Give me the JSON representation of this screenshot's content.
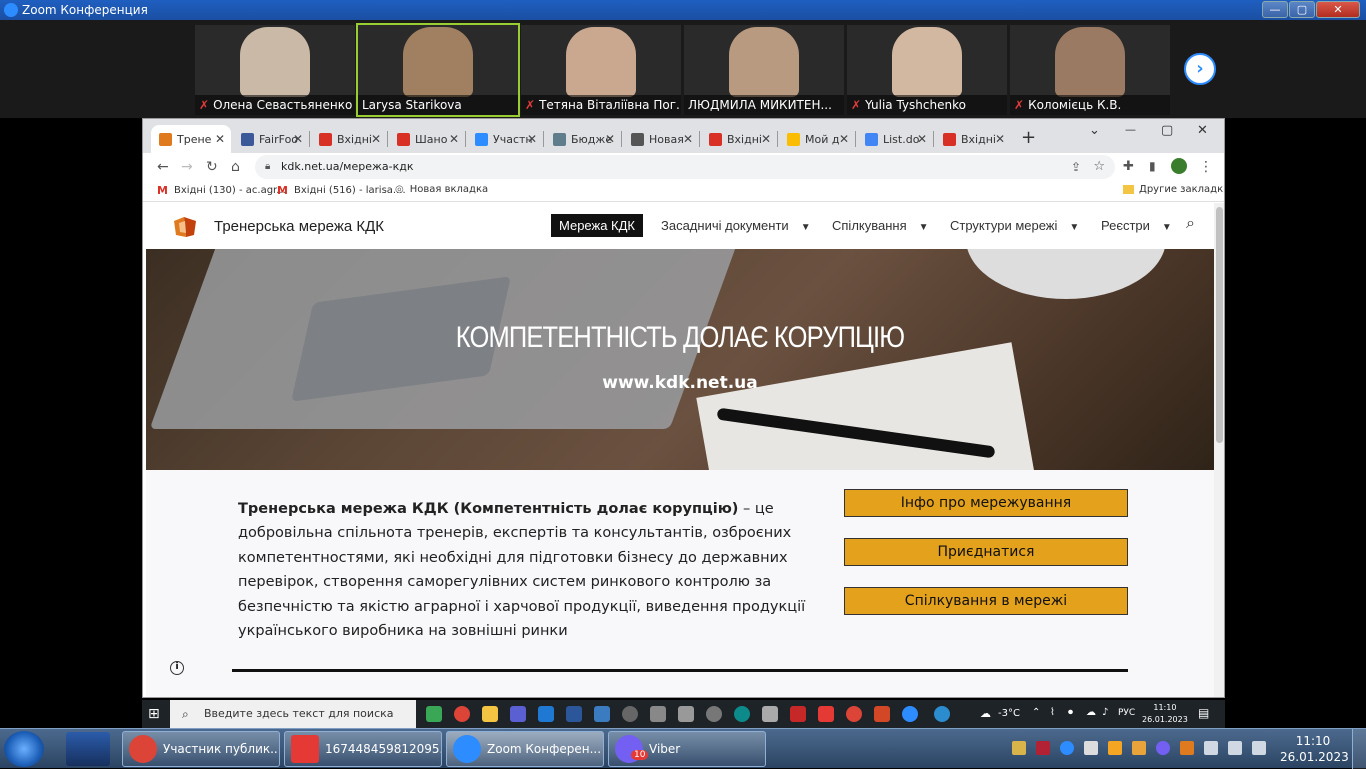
{
  "zoom": {
    "title": "Zoom Конференция",
    "controls": {
      "min": "—",
      "max": "▢",
      "close": "✕"
    },
    "participants": [
      {
        "name": "Олена Севастьяненко",
        "muted": true,
        "color": "#c9b9a6"
      },
      {
        "name": "Larysa Starikova",
        "muted": false,
        "color": "#a08060"
      },
      {
        "name": "Тетяна Віталіївна Пог...",
        "muted": true,
        "color": "#caa890"
      },
      {
        "name": "ЛЮДМИЛА МИКИТЕН...",
        "muted": false,
        "color": "#b89a80"
      },
      {
        "name": "Yulia Tyshchenko",
        "muted": true,
        "color": "#d2b8a0"
      },
      {
        "name": "Коломієць К.В.",
        "muted": true,
        "color": "#9a7a62"
      }
    ],
    "next": "›"
  },
  "browser": {
    "tabs": [
      {
        "label": "Трене",
        "color": "#e07a1f"
      },
      {
        "label": "FairFoo",
        "color": "#3b5998"
      },
      {
        "label": "Вхідні",
        "color": "#d93025"
      },
      {
        "label": "Шано",
        "color": "#d93025"
      },
      {
        "label": "Участн",
        "color": "#2d8cff"
      },
      {
        "label": "Бюдже",
        "color": "#607d8b"
      },
      {
        "label": "Новая",
        "color": "#555555"
      },
      {
        "label": "Вхідні",
        "color": "#d93025"
      },
      {
        "label": "Мой д",
        "color": "#fbbc04"
      },
      {
        "label": "List.do",
        "color": "#4285f4"
      },
      {
        "label": "Вхідні",
        "color": "#d93025"
      }
    ],
    "new_tab": "+",
    "window_controls": {
      "dropdown": "⌄",
      "min": "—",
      "max": "▢",
      "close": "✕"
    },
    "url": "kdk.net.ua/мережа-кдк",
    "bookmarks": [
      {
        "label": "Вхідні (130) - ac.agr..."
      },
      {
        "label": "Вхідні (516) - larisa...."
      },
      {
        "label": "Новая вкладка"
      }
    ],
    "other_bookmarks": "Другие закладки"
  },
  "site": {
    "name": "Тренерська мережа КДК",
    "nav": {
      "active": "Мережа КДК",
      "items": [
        "Засадничі документи",
        "Спілкування",
        "Структури мережі",
        "Реєстри"
      ]
    },
    "hero": {
      "title": "КОМПЕТЕНТНІСТЬ ДОЛАЄ КОРУПЦІЮ",
      "url": "www.kdk.net.ua"
    },
    "intro_bold": "Тренерська мережа КДК (Компетентність долає корупцію)",
    "intro_rest": " – це добровільна спільнота тренерів, експертів та консультантів, озброєних компетентностями, які необхідні для підготовки бізнесу до державних перевірок, створення саморегулівних систем ринкового контролю за безпечністю та якістю аграрної і харчової продукції, виведення продукції українського виробника на зовнішні ринки",
    "buttons": [
      "Інфо про мережування",
      "Приєднатися",
      "Спілкування в мережі"
    ],
    "accent": "#e4a11b"
  },
  "win10": {
    "search_placeholder": "Введите здесь текст для поиска",
    "weather": "-3°C",
    "lang": "РУС",
    "time": "11:10",
    "date": "26.01.2023"
  },
  "win7": {
    "tasks": [
      {
        "label": "Участник публик...",
        "color": "#db4437"
      },
      {
        "label": "167448459812095...",
        "color": "#e53935"
      },
      {
        "label": "Zoom Конферен...",
        "color": "#2d8cff"
      },
      {
        "label": "Viber",
        "color": "#7360f2"
      }
    ],
    "viber_badge": "10",
    "time": "11:10",
    "date": "26.01.2023"
  }
}
